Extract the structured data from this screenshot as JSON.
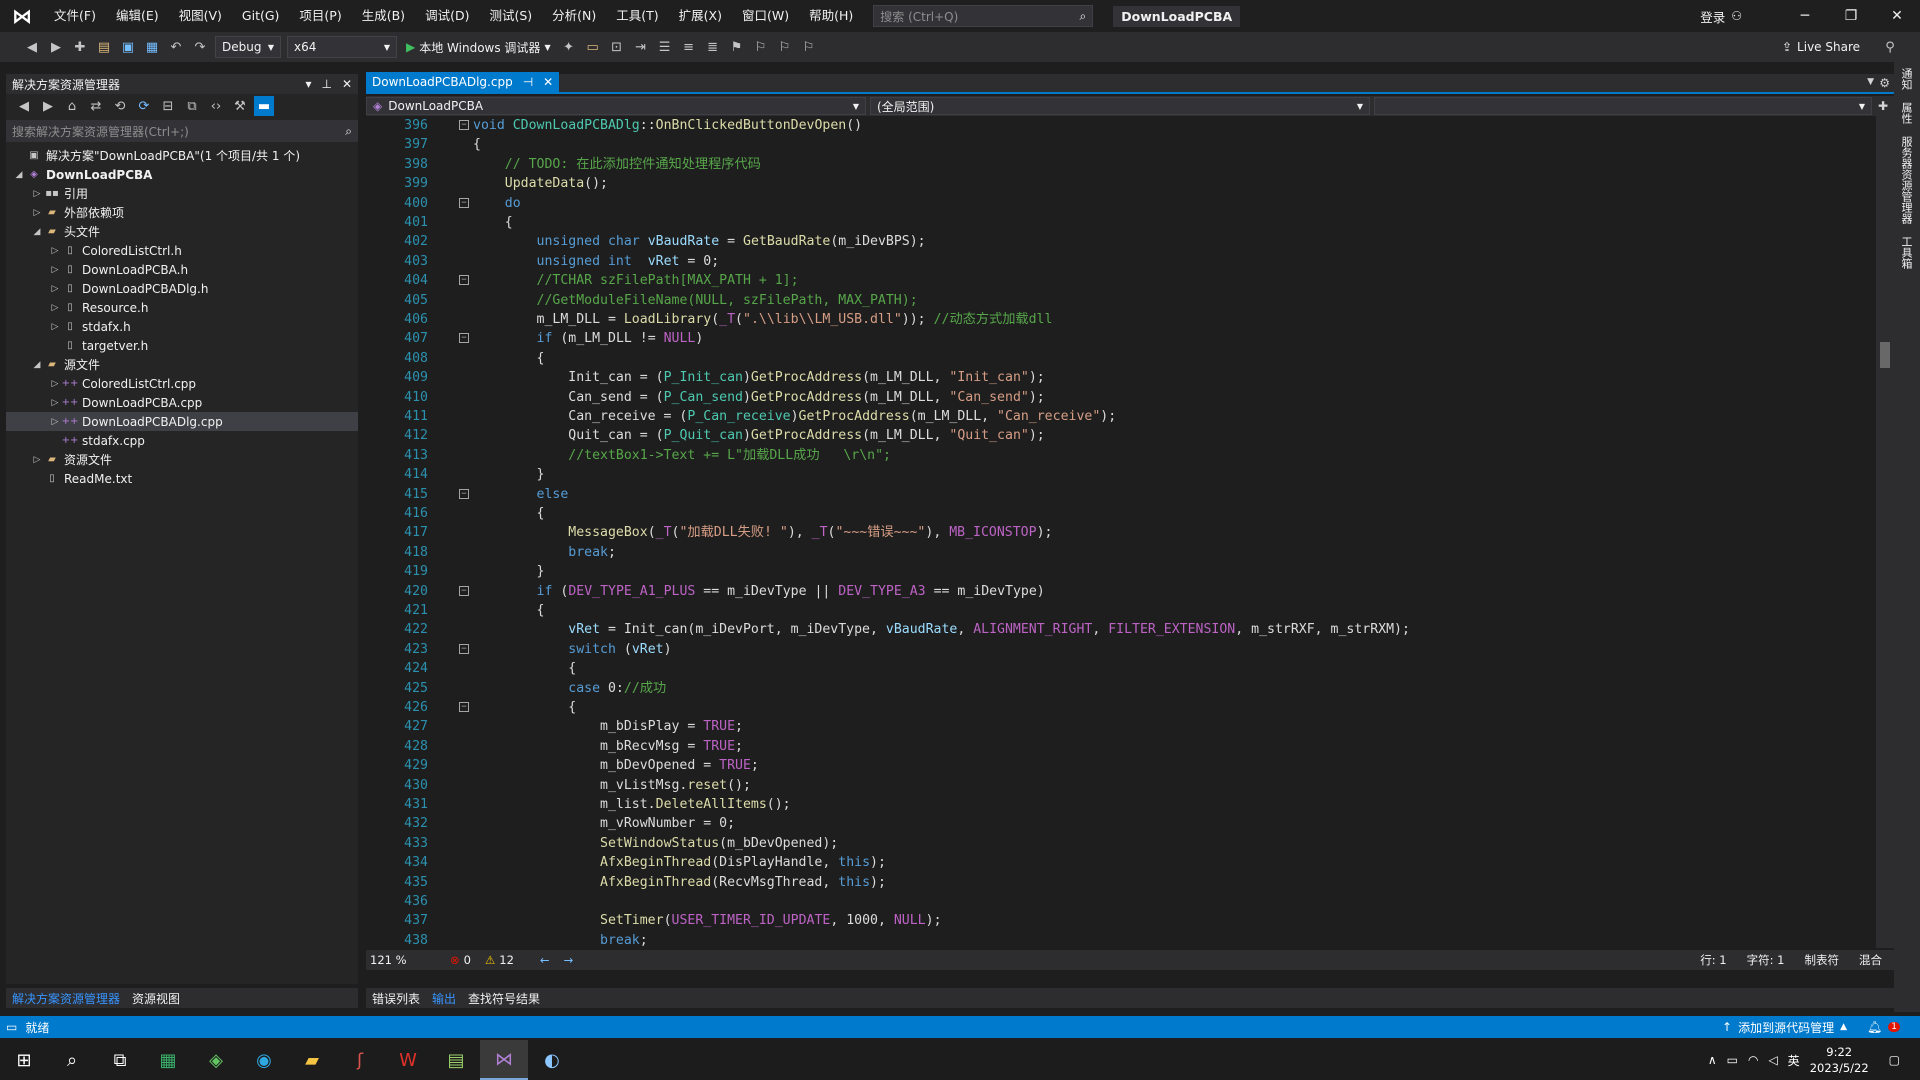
{
  "titlebar": {
    "menu": [
      "文件(F)",
      "编辑(E)",
      "视图(V)",
      "Git(G)",
      "项目(P)",
      "生成(B)",
      "调试(D)",
      "测试(S)",
      "分析(N)",
      "工具(T)",
      "扩展(X)",
      "窗口(W)",
      "帮助(H)"
    ],
    "search_placeholder": "搜索 (Ctrl+Q)",
    "solution_name": "DownLoadPCBA",
    "signin": "登录"
  },
  "toolbar": {
    "config": "Debug",
    "platform": "x64",
    "run_label": "本地 Windows 调试器",
    "liveshare": "Live Share"
  },
  "solution_explorer": {
    "title": "解决方案资源管理器",
    "search_placeholder": "搜索解决方案资源管理器(Ctrl+;)",
    "tree": [
      {
        "label": "解决方案\"DownLoadPCBA\"(1 个项目/共 1 个)",
        "icon": "solution-icon"
      },
      {
        "label": "DownLoadPCBA",
        "icon": "project-icon"
      },
      {
        "label": "引用",
        "icon": "references-icon"
      },
      {
        "label": "外部依赖项",
        "icon": "folder-icon"
      },
      {
        "label": "头文件",
        "icon": "folder-icon"
      },
      {
        "label": "ColoredListCtrl.h",
        "icon": "header-file-icon"
      },
      {
        "label": "DownLoadPCBA.h",
        "icon": "header-file-icon"
      },
      {
        "label": "DownLoadPCBADlg.h",
        "icon": "header-file-icon"
      },
      {
        "label": "Resource.h",
        "icon": "header-file-icon"
      },
      {
        "label": "stdafx.h",
        "icon": "header-file-icon"
      },
      {
        "label": "targetver.h",
        "icon": "header-file-icon"
      },
      {
        "label": "源文件",
        "icon": "folder-icon"
      },
      {
        "label": "ColoredListCtrl.cpp",
        "icon": "cpp-file-icon"
      },
      {
        "label": "DownLoadPCBA.cpp",
        "icon": "cpp-file-icon"
      },
      {
        "label": "DownLoadPCBADlg.cpp",
        "icon": "cpp-file-icon"
      },
      {
        "label": "stdafx.cpp",
        "icon": "cpp-file-icon"
      },
      {
        "label": "资源文件",
        "icon": "folder-icon"
      },
      {
        "label": "ReadMe.txt",
        "icon": "text-file-icon"
      }
    ],
    "bottom_tabs": [
      "解决方案资源管理器",
      "资源视图"
    ]
  },
  "editor": {
    "tab_label": "DownLoadPCBADlg.cpp",
    "nav_project": "DownLoadPCBA",
    "nav_scope": "(全局范围)",
    "zoom": "121 %",
    "errors": "0",
    "warnings": "12",
    "line_info": "行: 1",
    "char_info": "字符: 1",
    "tab_mode": "制表符",
    "eol_mode": "混合"
  },
  "output_tabs": [
    "错误列表",
    "输出",
    "查找符号结果"
  ],
  "right_strip": [
    "通知",
    "属性",
    "服务器资源管理器",
    "工具箱"
  ],
  "statusbar": {
    "ready": "就绪",
    "source_control": "添加到源代码管理",
    "notification_count": "1"
  },
  "taskbar": {
    "time": "9:22",
    "date": "2023/5/22",
    "ime": "英"
  }
}
